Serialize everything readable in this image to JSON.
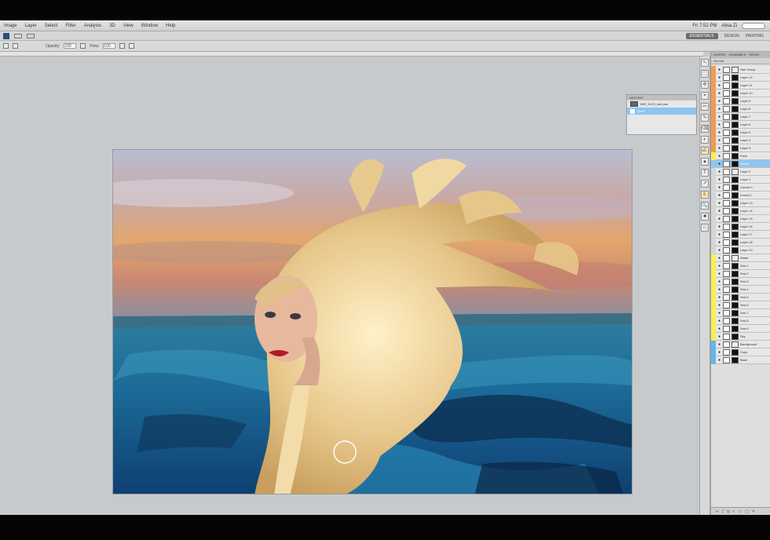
{
  "menubar": {
    "items": [
      "Image",
      "Layer",
      "Select",
      "Filter",
      "Analysis",
      "3D",
      "View",
      "Window",
      "Help"
    ],
    "clock": "Fri 7:52 PM",
    "user": "Alisa Zi"
  },
  "appbar": {
    "workspaces": [
      "ESSENTIALS",
      "DESIGN",
      "PAINTING"
    ]
  },
  "options": {
    "labels": [
      "Opacity:",
      "Flow:"
    ],
    "values": [
      "100",
      "100"
    ]
  },
  "navigator": {
    "title": "HISTORY",
    "items": [
      "IMG_0123_hair.psd",
      "Open"
    ]
  },
  "layers": {
    "tabs": [
      "LAYERS",
      "CHANNELS",
      "PATHS"
    ],
    "blend_mode": "Normal",
    "rows": [
      {
        "label": "Hair Group",
        "tag": "#f39a52",
        "kind": "group"
      },
      {
        "label": "Layer 12",
        "tag": "#f39a52",
        "kind": "mask"
      },
      {
        "label": "Layer 11",
        "tag": "#f39a52",
        "kind": "mask"
      },
      {
        "label": "Layer 10",
        "tag": "#f39a52",
        "kind": "mask"
      },
      {
        "label": "Layer 9",
        "tag": "#f39a52",
        "kind": "mask"
      },
      {
        "label": "Layer 8",
        "tag": "#f39a52",
        "kind": "mask"
      },
      {
        "label": "Layer 7",
        "tag": "#f39a52",
        "kind": "mask"
      },
      {
        "label": "Layer 6",
        "tag": "#f39a52",
        "kind": "mask"
      },
      {
        "label": "Layer 5",
        "tag": "#f39a52",
        "kind": "mask"
      },
      {
        "label": "Layer 4",
        "tag": "#f39a52",
        "kind": "mask"
      },
      {
        "label": "Layer 3",
        "tag": "#f39a52",
        "kind": "mask"
      },
      {
        "label": "Face",
        "tag": "#f7ef55",
        "kind": "mask"
      },
      {
        "label": "Model",
        "tag": "#8fc5ef",
        "kind": "sel"
      },
      {
        "label": "Layer 2",
        "tag": "#d5d5d5",
        "kind": "group"
      },
      {
        "label": "Layer 1",
        "tag": "#d5d5d5",
        "kind": "mask"
      },
      {
        "label": "Curves 1",
        "tag": "#d5d5d5",
        "kind": "mask"
      },
      {
        "label": "Levels 1",
        "tag": "#d5d5d5",
        "kind": "mask"
      },
      {
        "label": "Layer 13",
        "tag": "#d5d5d5",
        "kind": "mask"
      },
      {
        "label": "Layer 14",
        "tag": "#d5d5d5",
        "kind": "mask"
      },
      {
        "label": "Layer 15",
        "tag": "#d5d5d5",
        "kind": "mask"
      },
      {
        "label": "Layer 16",
        "tag": "#d5d5d5",
        "kind": "mask"
      },
      {
        "label": "Layer 17",
        "tag": "#d5d5d5",
        "kind": "mask"
      },
      {
        "label": "Layer 18",
        "tag": "#d5d5d5",
        "kind": "mask"
      },
      {
        "label": "Layer 19",
        "tag": "#d5d5d5",
        "kind": "mask"
      },
      {
        "label": "Water",
        "tag": "#f7ef55",
        "kind": "group"
      },
      {
        "label": "Sea 1",
        "tag": "#f7ef55",
        "kind": "mask"
      },
      {
        "label": "Sea 2",
        "tag": "#f7ef55",
        "kind": "mask"
      },
      {
        "label": "Sea 3",
        "tag": "#f7ef55",
        "kind": "mask"
      },
      {
        "label": "Sea 4",
        "tag": "#f7ef55",
        "kind": "mask"
      },
      {
        "label": "Sea 5",
        "tag": "#f7ef55",
        "kind": "mask"
      },
      {
        "label": "Sea 6",
        "tag": "#f7ef55",
        "kind": "mask"
      },
      {
        "label": "Sea 7",
        "tag": "#f7ef55",
        "kind": "mask"
      },
      {
        "label": "Sea 8",
        "tag": "#f7ef55",
        "kind": "mask"
      },
      {
        "label": "Sea 9",
        "tag": "#f7ef55",
        "kind": "mask"
      },
      {
        "label": "Sky",
        "tag": "#f7ef55",
        "kind": "mask"
      },
      {
        "label": "Background",
        "tag": "#62b6ee",
        "kind": "group"
      },
      {
        "label": "Copy",
        "tag": "#62b6ee",
        "kind": "mask"
      },
      {
        "label": "Base",
        "tag": "#62b6ee",
        "kind": "mask"
      }
    ]
  },
  "tools": [
    "↖",
    "⬚",
    "✣",
    "⌖",
    "✂",
    "✎",
    "⌫",
    "◐",
    "✍",
    "▲",
    "T",
    "↗",
    "✋",
    "🔍",
    "■",
    "□"
  ],
  "colors": {
    "selection": "#8fc5ef",
    "orange_tag": "#f39a52",
    "yellow_tag": "#f7ef55",
    "blue_tag": "#62b6ee"
  }
}
